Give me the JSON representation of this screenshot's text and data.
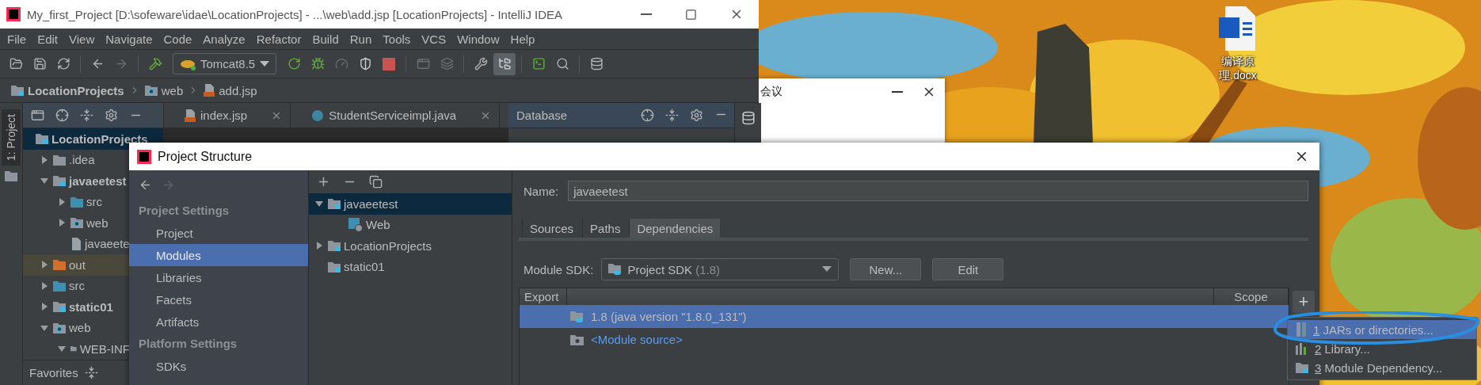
{
  "desktop_icons": [
    {
      "label": "编译原理.docx"
    }
  ],
  "ide": {
    "title": "My_first_Project [D:\\sofeware\\idae\\LocationProjects] - ...\\web\\add.jsp [LocationProjects] - IntelliJ IDEA",
    "menu": [
      "File",
      "Edit",
      "View",
      "Navigate",
      "Code",
      "Analyze",
      "Refactor",
      "Build",
      "Run",
      "Tools",
      "VCS",
      "Window",
      "Help"
    ],
    "run_config": "Tomcat8.5",
    "breadcrumb": [
      {
        "label": "LocationProjects",
        "kind": "module"
      },
      {
        "label": "web",
        "kind": "web"
      },
      {
        "label": "add.jsp",
        "kind": "jsp"
      }
    ],
    "side_tab": {
      "label": "1: Project",
      "selected": true
    },
    "project_tree": [
      {
        "label": "LocationProjects",
        "kind": "module",
        "bold": true,
        "selected": true,
        "children": [
          {
            "label": ".idea",
            "kind": "folder",
            "bold": false,
            "selected": false,
            "expanded": false
          },
          {
            "label": "javaeetest",
            "kind": "module",
            "bold": true,
            "selected": false,
            "expanded": true,
            "children": [
              {
                "label": "src",
                "kind": "source",
                "bold": false,
                "selected": false,
                "expanded": false
              },
              {
                "label": "web",
                "kind": "web",
                "bold": false,
                "selected": false,
                "expanded": false
              },
              {
                "label": "javaeete",
                "kind": "file",
                "bold": false,
                "selected": false
              }
            ]
          },
          {
            "label": "out",
            "kind": "excluded",
            "bold": false,
            "selected": false,
            "expanded": false
          },
          {
            "label": "src",
            "kind": "source",
            "bold": false,
            "selected": false,
            "expanded": false
          },
          {
            "label": "static01",
            "kind": "module",
            "bold": true,
            "selected": false,
            "expanded": false
          },
          {
            "label": "web",
            "kind": "web",
            "bold": false,
            "selected": false,
            "expanded": true,
            "children": [
              {
                "label": "WEB-INF",
                "kind": "folder",
                "bold": false,
                "selected": false,
                "expanded": true
              }
            ]
          }
        ]
      }
    ],
    "favorites": "Favorites",
    "editor_tabs": [
      {
        "label": "index.jsp",
        "kind": "jsp",
        "selected": false
      },
      {
        "label": "StudentServiceimpl.java",
        "kind": "class",
        "selected": false
      }
    ],
    "database_panel": {
      "title": "Database"
    }
  },
  "meeting_window": {
    "title": "会议"
  },
  "dialog": {
    "title": "Project Structure",
    "sidebar": [
      {
        "heading": "Project Settings",
        "items": [
          {
            "label": "Project",
            "selected": false
          },
          {
            "label": "Modules",
            "selected": true
          },
          {
            "label": "Libraries",
            "selected": false
          },
          {
            "label": "Facets",
            "selected": false
          },
          {
            "label": "Artifacts",
            "selected": false
          }
        ]
      },
      {
        "heading": "Platform Settings",
        "items": [
          {
            "label": "SDKs",
            "selected": false
          }
        ]
      }
    ],
    "modules": [
      {
        "label": "javaeetest",
        "kind": "module",
        "selected": true,
        "expanded": true,
        "children": [
          {
            "label": "Web",
            "kind": "facet",
            "selected": false
          }
        ]
      },
      {
        "label": "LocationProjects",
        "kind": "module",
        "selected": false,
        "expanded": false
      },
      {
        "label": "static01",
        "kind": "module",
        "selected": false
      }
    ],
    "name_field": {
      "label": "Name:",
      "value": "javaeetest"
    },
    "tabs": [
      {
        "label": "Sources",
        "selected": false
      },
      {
        "label": "Paths",
        "selected": false
      },
      {
        "label": "Dependencies",
        "selected": true
      }
    ],
    "sdk": {
      "label": "Module SDK:",
      "value": "Project SDK",
      "version": "(1.8)"
    },
    "buttons": [
      "New...",
      "Edit"
    ],
    "table": {
      "columns": [
        "Export",
        "Scope"
      ],
      "rows": [
        {
          "label": "1.8 (java version \"1.8.0_131\")",
          "kind": "sdk",
          "selected": true
        },
        {
          "label": "<Module source>",
          "kind": "source",
          "selected": false
        }
      ]
    },
    "add_button": "+",
    "add_menu": [
      {
        "key": "1",
        "label": "JARs or directories...",
        "kind": "jars",
        "selected": true
      },
      {
        "key": "2",
        "label": "Library...",
        "kind": "library",
        "selected": false
      },
      {
        "key": "3",
        "label": "Module Dependency...",
        "kind": "module",
        "selected": false
      }
    ]
  }
}
